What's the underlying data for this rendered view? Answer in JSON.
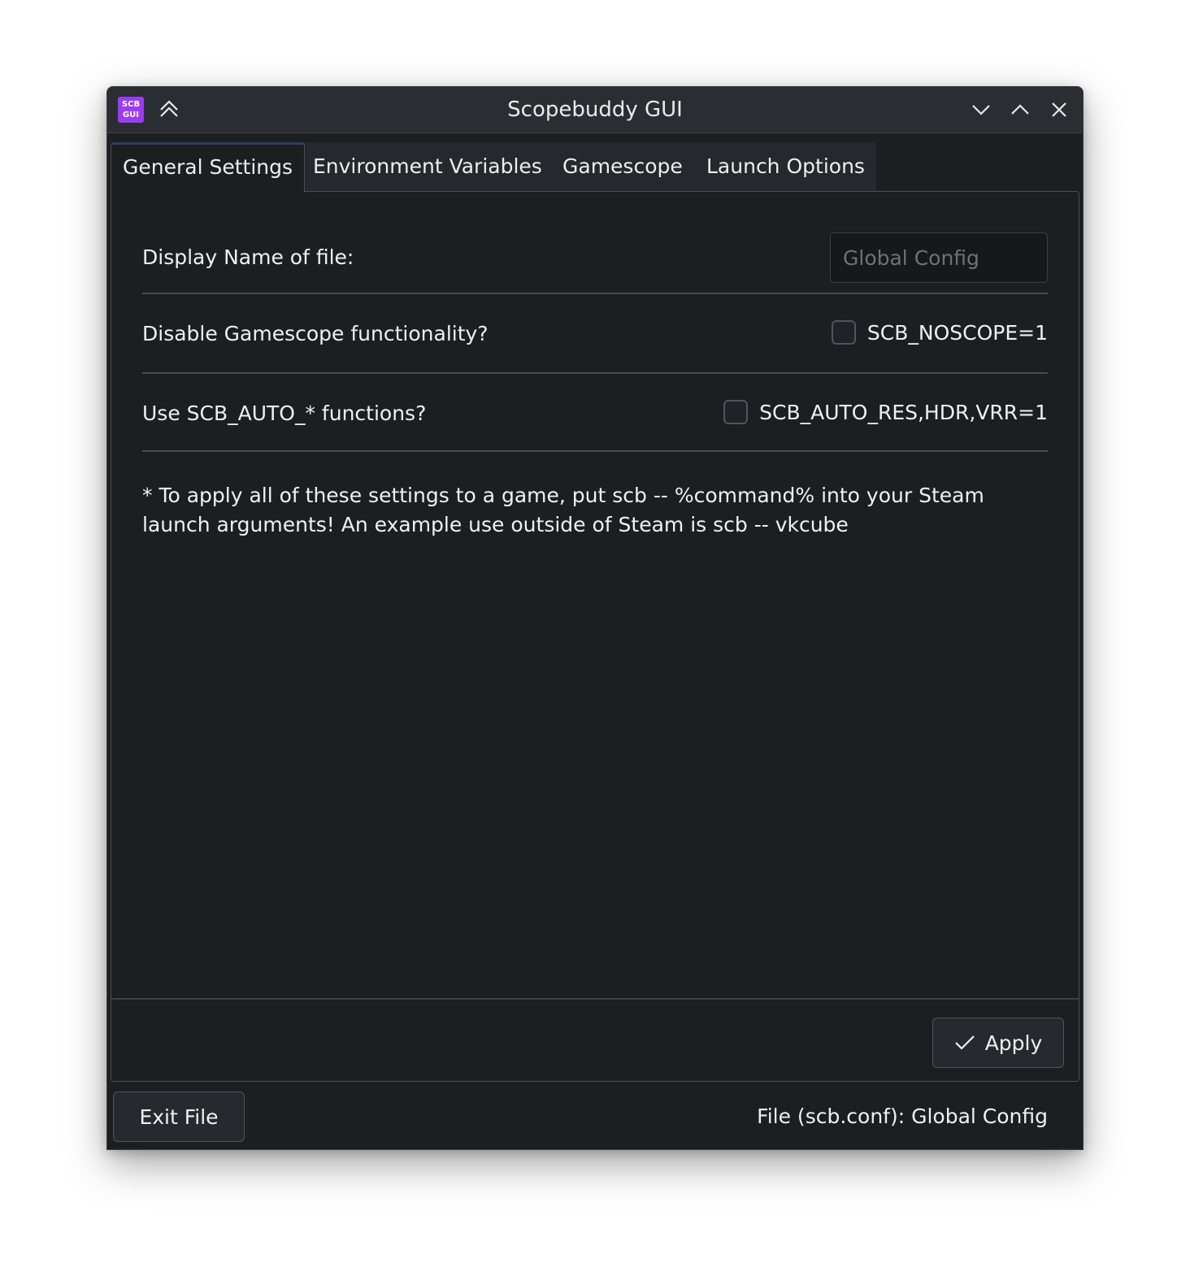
{
  "window": {
    "title": "Scopebuddy GUI",
    "app_icon_text_top": "SCB",
    "app_icon_text_bottom": "GUI",
    "app_icon_color": "#9b3cf0",
    "controls": [
      "keep-above-icon",
      "minimize-icon",
      "maximize-icon",
      "close-icon"
    ]
  },
  "tabs": [
    {
      "label": "General Settings",
      "active": true
    },
    {
      "label": "Environment Variables",
      "active": false
    },
    {
      "label": "Gamescope",
      "active": false
    },
    {
      "label": "Launch Options",
      "active": false
    }
  ],
  "general": {
    "display_name_label": "Display Name of file:",
    "display_name_placeholder": "Global Config",
    "display_name_value": "",
    "noscope_label": "Disable Gamescope functionality?",
    "noscope_checkbox_label": "SCB_NOSCOPE=1",
    "noscope_checked": false,
    "auto_label": "Use SCB_AUTO_* functions?",
    "auto_checkbox_label": "SCB_AUTO_RES,HDR,VRR=1",
    "auto_checked": false,
    "note": "* To apply all of these settings to a game, put scb -- %command% into your Steam launch arguments! An example use outside of Steam is scb -- vkcube"
  },
  "actions": {
    "apply_label": "Apply",
    "exit_label": "Exit File"
  },
  "status": {
    "file_text": "File (scb.conf): Global Config"
  }
}
